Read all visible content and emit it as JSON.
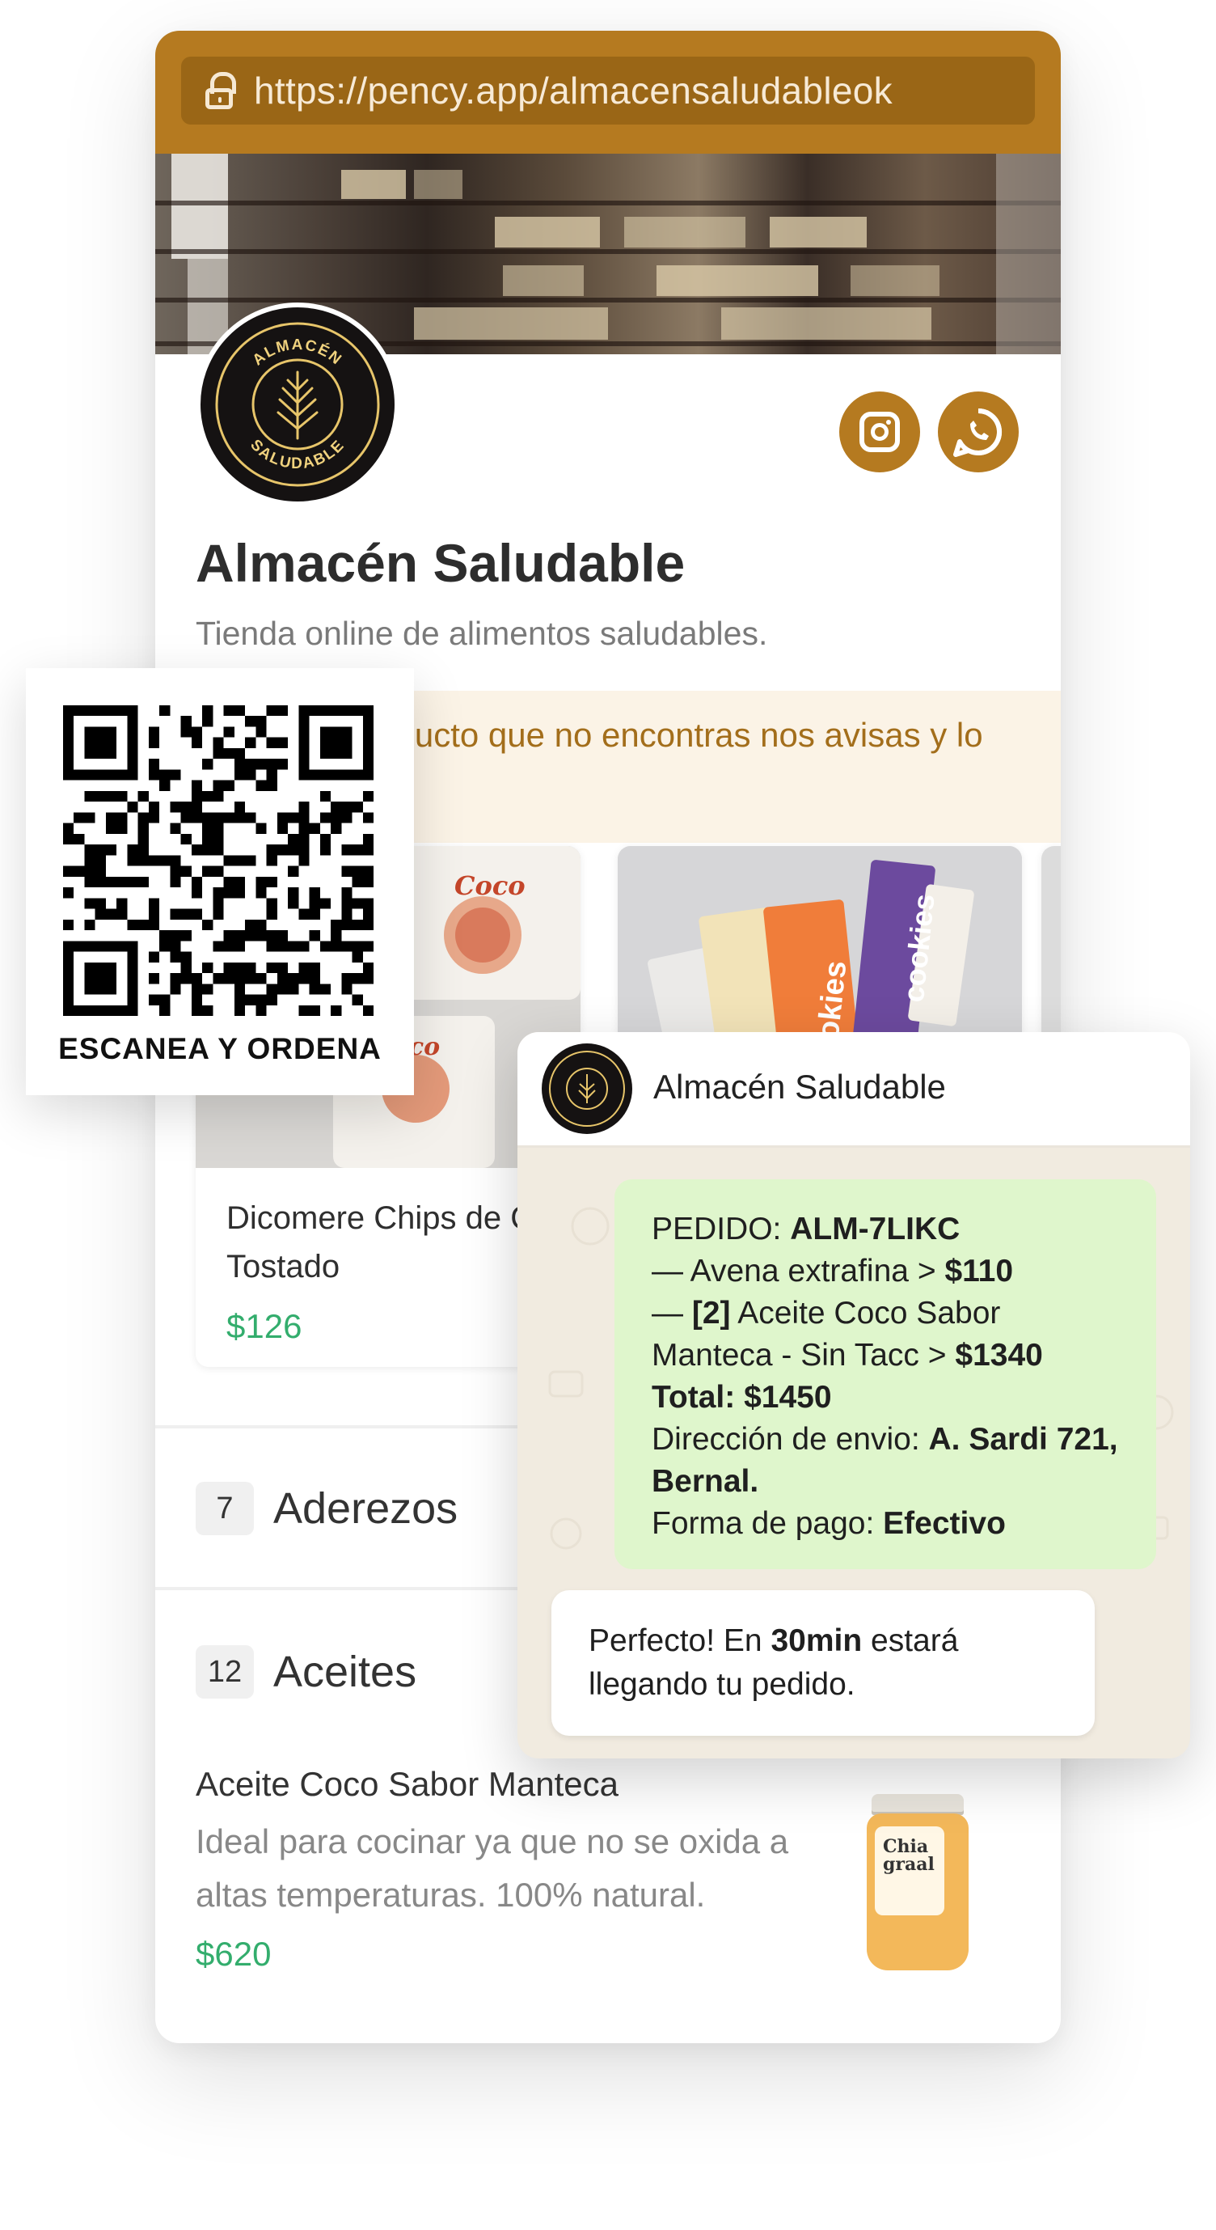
{
  "browser": {
    "url": "https://pency.app/almacensaludableok"
  },
  "store": {
    "name": "Almacén Saludable",
    "description": "Tienda online de alimentos saludables.",
    "logo_text_top": "ALMACÉN",
    "logo_text_bottom": "SALUDABLE",
    "notice": "Si hay un producto que no encontras nos avisas y lo agregamos😊",
    "social": [
      "instagram-icon",
      "whatsapp-icon"
    ]
  },
  "products": [
    {
      "title": "Dicomere Chips de Coco Tostado",
      "price": "$126"
    },
    {
      "title": "",
      "price": ""
    }
  ],
  "categories": [
    {
      "count": "7",
      "name": "Aderezos"
    },
    {
      "count": "12",
      "name": "Aceites"
    }
  ],
  "featured_product": {
    "title": "Aceite Coco Sabor Manteca",
    "description": "Ideal para cocinar ya que no se oxida a altas temperaturas. 100% natural.",
    "price": "$620"
  },
  "qr": {
    "caption": "ESCANEA Y ORDENA"
  },
  "whatsapp": {
    "contact": "Almacén Saludable",
    "order": {
      "label": "PEDIDO: ",
      "code": "ALM-7LIKC",
      "item1_text": "— Avena extrafina > ",
      "item1_price": "$110",
      "item2_prefix": "— ",
      "item2_qty": "[2]",
      "item2_text": " Aceite Coco Sabor Manteca - Sin Tacc > ",
      "item2_price": "$1340",
      "total": "Total: $1450",
      "address_label": "Dirección de envio: ",
      "address": "A. Sardi 721, Bernal.",
      "payment_label": "Forma de pago: ",
      "payment": "Efectivo"
    },
    "reply": {
      "before": "Perfecto! En ",
      "bold": "30min",
      "after": " estará llegando tu pedido."
    }
  },
  "colors": {
    "accent": "#b57a20",
    "price": "#33ad6d",
    "bubble": "#dff6cc"
  }
}
